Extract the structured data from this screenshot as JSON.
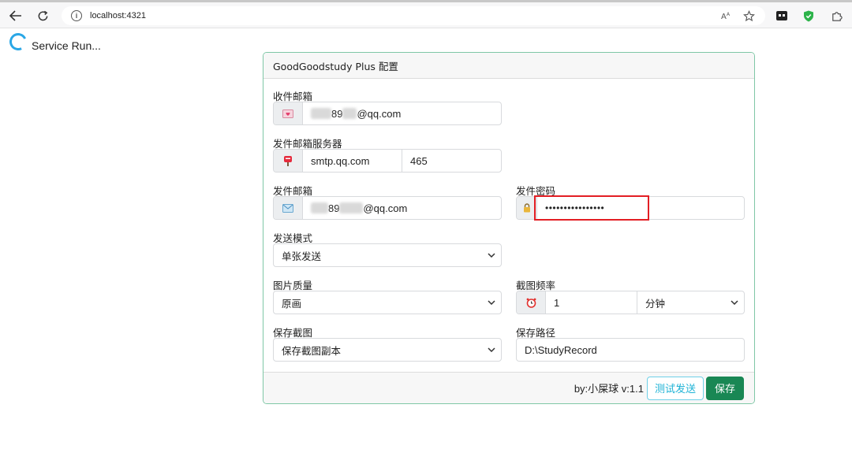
{
  "browser": {
    "url": "localhost:4321"
  },
  "service": {
    "status_text": "Service Run..."
  },
  "card": {
    "title": "GoodGoodstudy Plus 配置",
    "receiver_email": {
      "label": "收件邮箱",
      "icon": "love-letter-icon",
      "value_visible_mid": "89",
      "value_visible_suffix": "@qq.com"
    },
    "smtp": {
      "label": "发件邮箱服务器",
      "icon": "postbox-icon",
      "host": "smtp.qq.com",
      "port": "465"
    },
    "sender_email": {
      "label": "发件邮箱",
      "icon": "envelope-icon",
      "value_visible_mid": "89",
      "value_visible_suffix": "@qq.com"
    },
    "sender_password": {
      "label": "发件密码",
      "icon": "lock-icon",
      "masked_value": "••••••••••••••••"
    },
    "send_mode": {
      "label": "发送模式",
      "selected": "单张发送"
    },
    "image_quality": {
      "label": "图片质量",
      "selected": "原画"
    },
    "capture_frequency": {
      "label": "截图频率",
      "icon": "alarm-clock-icon",
      "value": "1",
      "unit_selected": "分钟"
    },
    "save_capture": {
      "label": "保存截图",
      "selected": "保存截图副本"
    },
    "save_path": {
      "label": "保存路径",
      "value": "D:\\StudyRecord"
    },
    "footer": {
      "credit": "by:小屎球 v:1.1",
      "test_button": "测试发送",
      "save_button": "保存"
    }
  },
  "colors": {
    "card_border": "#7fc7a6",
    "save_button": "#198754",
    "test_button": "#1fb3d6",
    "highlight_box": "#e31e24",
    "spinner": "#2aa7e6"
  }
}
